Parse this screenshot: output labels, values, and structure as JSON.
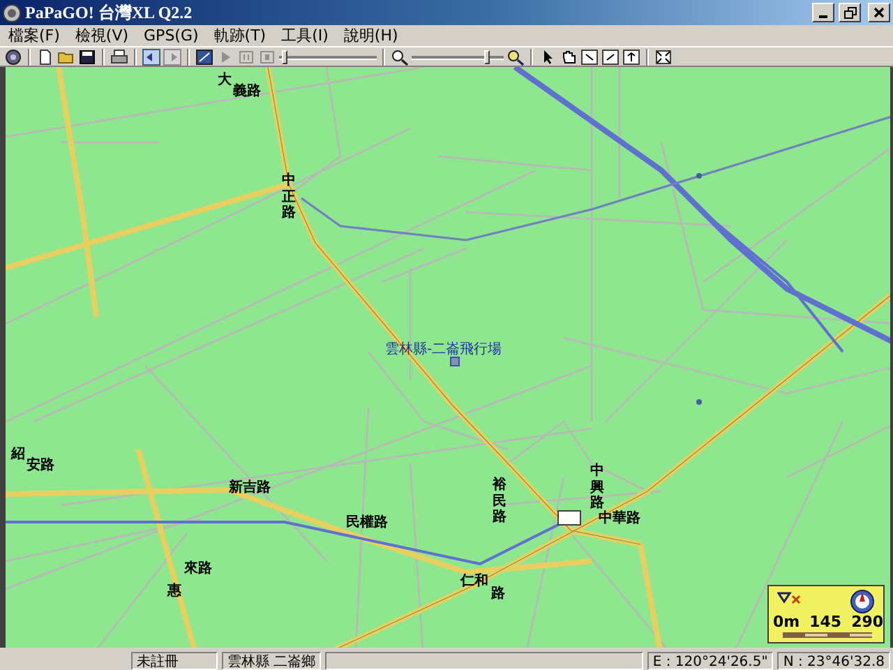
{
  "window": {
    "title": "PaPaGO! 台灣XL Q2.2"
  },
  "menu": [
    "檔案(F)",
    "檢視(V)",
    "GPS(G)",
    "軌跡(T)",
    "工具(I)",
    "說明(H)"
  ],
  "toolbar": {
    "track_slider": {
      "level": 0.05
    },
    "zoom_slider": {
      "level": 0.82
    }
  },
  "map": {
    "labels": [
      {
        "text": "大",
        "kind": "horizontal"
      },
      {
        "text": "義路",
        "kind": "horizontal"
      },
      {
        "text": "中正路",
        "kind": "vertical"
      },
      {
        "text": "雲林縣-二崙飛行場",
        "kind": "place"
      },
      {
        "text": "紹",
        "kind": "horizontal"
      },
      {
        "text": "安路",
        "kind": "horizontal"
      },
      {
        "text": "新吉路",
        "kind": "horizontal"
      },
      {
        "text": "民權路",
        "kind": "horizontal"
      },
      {
        "text": "裕民路",
        "kind": "vertical"
      },
      {
        "text": "中興路",
        "kind": "vertical"
      },
      {
        "text": "中華路",
        "kind": "horizontal"
      },
      {
        "text": "仁和",
        "kind": "horizontal"
      },
      {
        "text": "路",
        "kind": "horizontal"
      },
      {
        "text": "來路",
        "kind": "horizontal"
      },
      {
        "text": "惠",
        "kind": "horizontal"
      }
    ],
    "scale": [
      "0m",
      "145",
      "290"
    ]
  },
  "status_bar": [
    "未註冊",
    "雲林縣 二崙鄉",
    "E : 120°24'26.5\"",
    "N : 23°46'32.8"
  ]
}
